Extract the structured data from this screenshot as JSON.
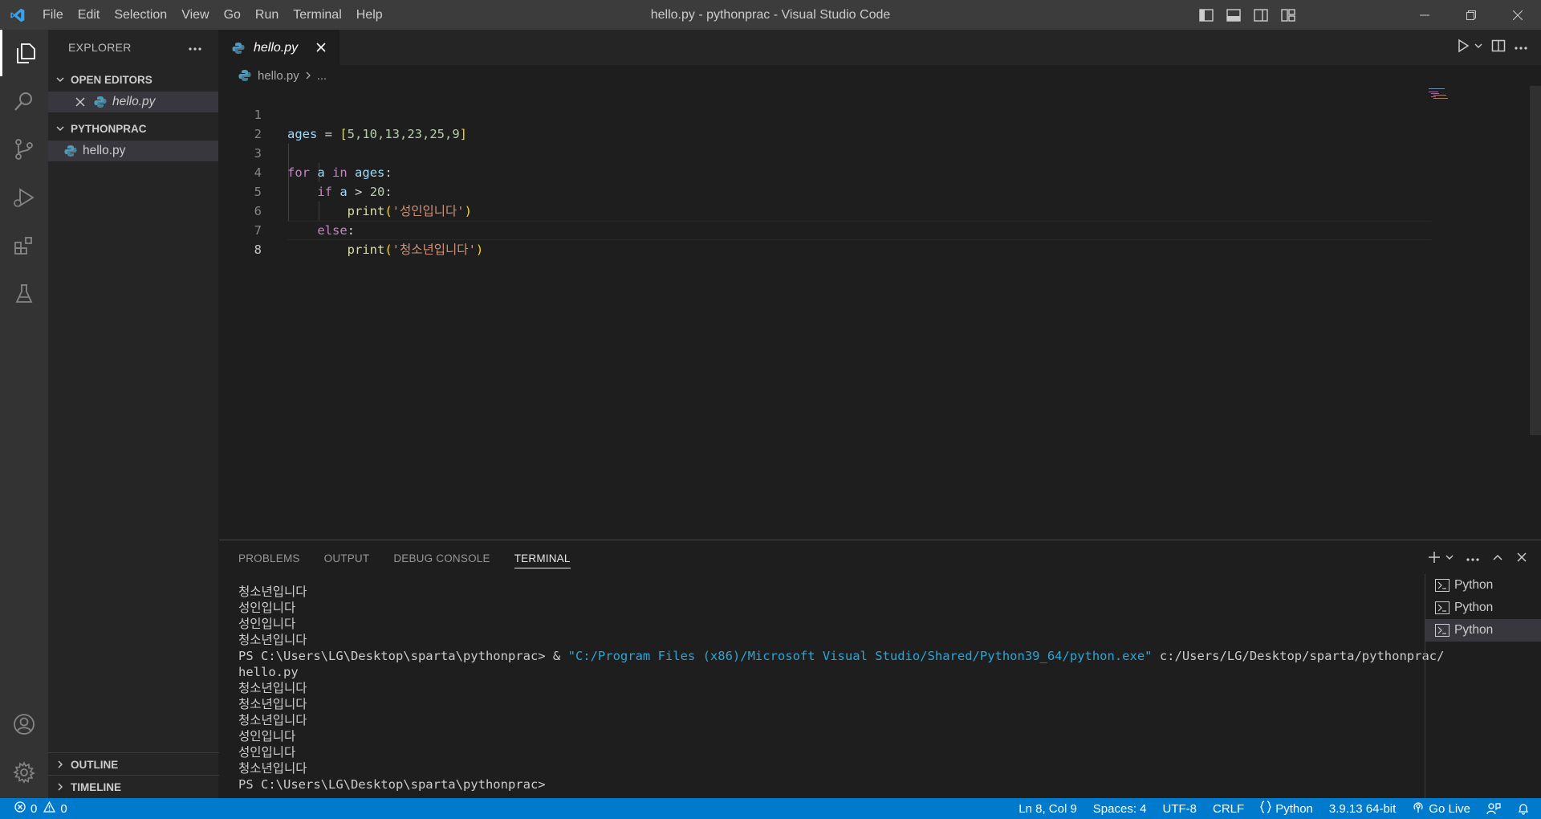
{
  "titlebar": {
    "menu": [
      "File",
      "Edit",
      "Selection",
      "View",
      "Go",
      "Run",
      "Terminal",
      "Help"
    ],
    "window_title": "hello.py - pythonprac - Visual Studio Code"
  },
  "sidebar": {
    "title": "EXPLORER",
    "open_editors_label": "OPEN EDITORS",
    "open_editors": [
      {
        "name": "hello.py"
      }
    ],
    "folder_label": "PYTHONPRAC",
    "files": [
      {
        "name": "hello.py"
      }
    ],
    "outline_label": "OUTLINE",
    "timeline_label": "TIMELINE"
  },
  "editor": {
    "tab_label": "hello.py",
    "breadcrumb_file": "hello.py",
    "breadcrumb_more": "...",
    "line_numbers": [
      "1",
      "2",
      "3",
      "4",
      "5",
      "6",
      "7",
      "8"
    ],
    "code": {
      "l1_var": "ages",
      "l1_eq": " = ",
      "l1_open": "[",
      "l1_nums": "5,10,13,23,25,9",
      "l1_close": "]",
      "l3_for": "for",
      "l3_a": "a",
      "l3_in": "in",
      "l3_ages": "ages",
      "l3_colon": ":",
      "l4_if": "if",
      "l4_a": "a",
      "l4_gt": " > ",
      "l4_num": "20",
      "l4_colon": ":",
      "l5_fn": "print",
      "l5_open": "(",
      "l5_str": "'성인입니다'",
      "l5_close": ")",
      "l6_else": "else",
      "l6_colon": ":",
      "l7_fn": "print",
      "l7_open": "(",
      "l7_str": "'청소년입니다'",
      "l7_close": ")"
    }
  },
  "panel": {
    "tabs": [
      "PROBLEMS",
      "OUTPUT",
      "DEBUG CONSOLE",
      "TERMINAL"
    ],
    "active_tab": "TERMINAL",
    "terminal_lines_top": [
      "청소년입니다",
      "성인입니다",
      "성인입니다",
      "청소년입니다"
    ],
    "cmd_prompt": "PS C:\\Users\\LG\\Desktop\\sparta\\pythonprac> & ",
    "cmd_exe": "\"C:/Program Files (x86)/Microsoft Visual Studio/Shared/Python39_64/python.exe\"",
    "cmd_arg": " c:/Users/LG/Desktop/sparta/pythonprac/",
    "cmd_arg_wrap": "hello.py",
    "terminal_lines_bottom": [
      "청소년입니다",
      "청소년입니다",
      "청소년입니다",
      "성인입니다",
      "성인입니다",
      "청소년입니다"
    ],
    "final_prompt": "PS C:\\Users\\LG\\Desktop\\sparta\\pythonprac>",
    "terminals": [
      "Python",
      "Python",
      "Python"
    ]
  },
  "statusbar": {
    "errors": "0",
    "warnings": "0",
    "position": "Ln 8, Col 9",
    "spaces": "Spaces: 4",
    "encoding": "UTF-8",
    "eol": "CRLF",
    "language": "Python",
    "interpreter": "3.9.13 64-bit",
    "go_live": "Go Live"
  },
  "colors": {
    "accent": "#007acc",
    "keyword": "#c586c0",
    "variable": "#9cdcfe",
    "number": "#b5cea8",
    "function": "#dcdcaa",
    "string": "#ce9178"
  }
}
